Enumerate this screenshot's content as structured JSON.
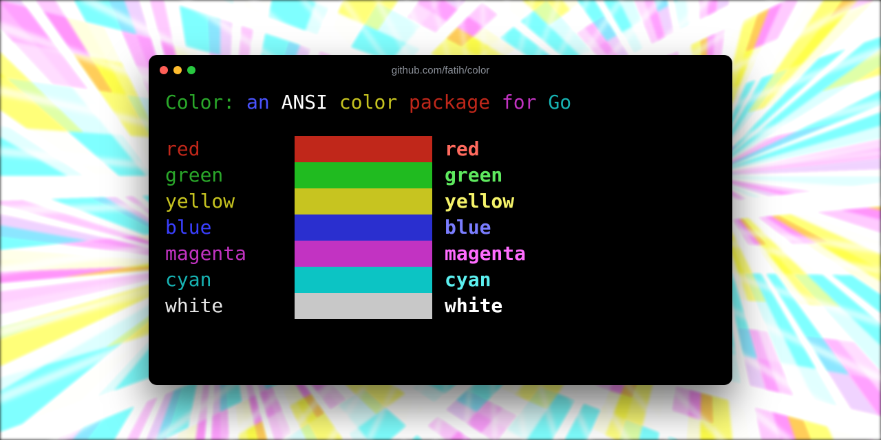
{
  "window": {
    "title": "github.com/fatih/color",
    "traffic_lights": {
      "close": "#ff5f57",
      "minimize": "#febc2e",
      "zoom": "#28c840"
    }
  },
  "headline": [
    {
      "text": "Color:",
      "color": "#2aa82a"
    },
    {
      "text": " ",
      "color": "#ffffff"
    },
    {
      "text": "an",
      "color": "#4a53ff"
    },
    {
      "text": " ",
      "color": "#ffffff"
    },
    {
      "text": "ANSI",
      "color": "#ffffff"
    },
    {
      "text": " ",
      "color": "#ffffff"
    },
    {
      "text": "color",
      "color": "#c7c420"
    },
    {
      "text": " ",
      "color": "#ffffff"
    },
    {
      "text": "package",
      "color": "#c0271a"
    },
    {
      "text": " ",
      "color": "#ffffff"
    },
    {
      "text": "for",
      "color": "#c233c2"
    },
    {
      "text": " ",
      "color": "#ffffff"
    },
    {
      "text": "Go",
      "color": "#17b3b3"
    }
  ],
  "rows": [
    {
      "name": "red",
      "dim": "#c0271a",
      "swatch": "#c0271a",
      "bright": "#ff6a5e"
    },
    {
      "name": "green",
      "dim": "#2aa82a",
      "swatch": "#20bb20",
      "bright": "#5ee85e"
    },
    {
      "name": "yellow",
      "dim": "#c7c420",
      "swatch": "#c7c420",
      "bright": "#f5f36a"
    },
    {
      "name": "blue",
      "dim": "#3a3fff",
      "swatch": "#2a2fcf",
      "bright": "#7a7dff"
    },
    {
      "name": "magenta",
      "dim": "#c233c2",
      "swatch": "#c233c2",
      "bright": "#ff6cff"
    },
    {
      "name": "cyan",
      "dim": "#17b3b3",
      "swatch": "#0cc4c4",
      "bright": "#5cf0f0"
    },
    {
      "name": "white",
      "dim": "#e8e8e8",
      "swatch": "#c8c8c8",
      "bright": "#ffffff"
    }
  ]
}
